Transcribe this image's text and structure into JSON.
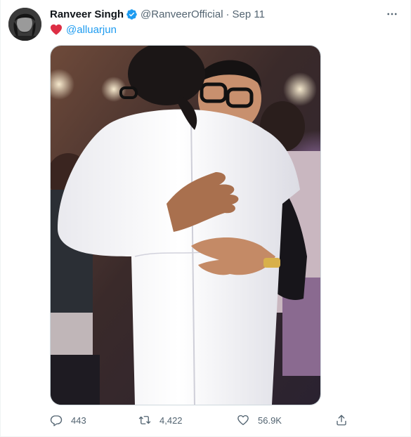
{
  "author": {
    "name": "Ranveer Singh",
    "handle": "@RanveerOfficial",
    "separator": "·",
    "date": "Sep 11"
  },
  "tweet": {
    "mention": "@alluarjun"
  },
  "actions": {
    "replies": "443",
    "retweets": "4,422",
    "likes": "56.9K"
  },
  "icons": {
    "verified": "verified-badge-icon",
    "heart_emoji": "red-heart-icon",
    "more": "more-options-icon",
    "reply": "reply-icon",
    "retweet": "retweet-icon",
    "like": "like-icon",
    "share": "share-icon"
  },
  "colors": {
    "accent": "#1d9bf0",
    "secondary_text": "#536471",
    "heart": "#e0245e"
  }
}
